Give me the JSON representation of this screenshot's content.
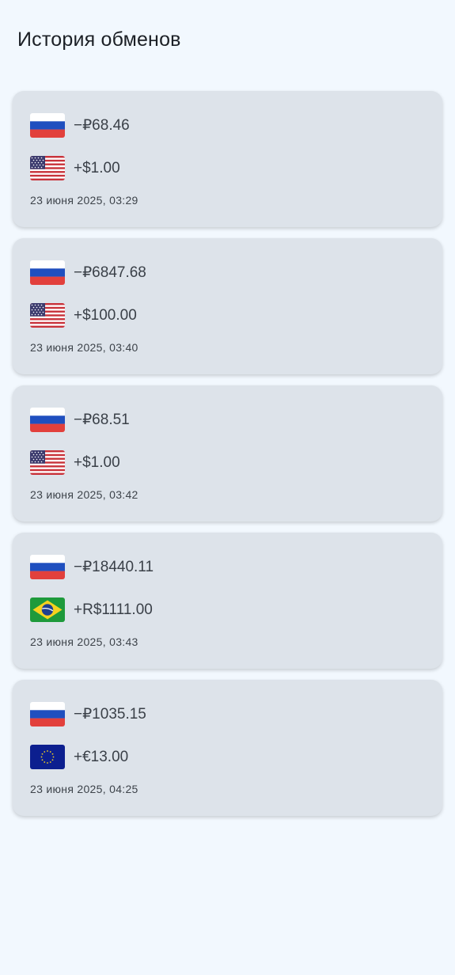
{
  "header": {
    "title": "История обменов"
  },
  "exchanges": [
    {
      "from": {
        "flag": "ru-flag-icon",
        "amount": "−₽68.46"
      },
      "to": {
        "flag": "us-flag-icon",
        "amount": "+$1.00"
      },
      "date": "23 июня 2025, 03:29"
    },
    {
      "from": {
        "flag": "ru-flag-icon",
        "amount": "−₽6847.68"
      },
      "to": {
        "flag": "us-flag-icon",
        "amount": "+$100.00"
      },
      "date": "23 июня 2025, 03:40"
    },
    {
      "from": {
        "flag": "ru-flag-icon",
        "amount": "−₽68.51"
      },
      "to": {
        "flag": "us-flag-icon",
        "amount": "+$1.00"
      },
      "date": "23 июня 2025, 03:42"
    },
    {
      "from": {
        "flag": "ru-flag-icon",
        "amount": "−₽18440.11"
      },
      "to": {
        "flag": "br-flag-icon",
        "amount": "+R$1111.00"
      },
      "date": "23 июня 2025, 03:43"
    },
    {
      "from": {
        "flag": "ru-flag-icon",
        "amount": "−₽1035.15"
      },
      "to": {
        "flag": "eu-flag-icon",
        "amount": "+€13.00"
      },
      "date": "23 июня 2025, 04:25"
    }
  ],
  "colors": {
    "background": "#f2f8fe",
    "card": "#dde3ea",
    "text": "#3a4048"
  }
}
